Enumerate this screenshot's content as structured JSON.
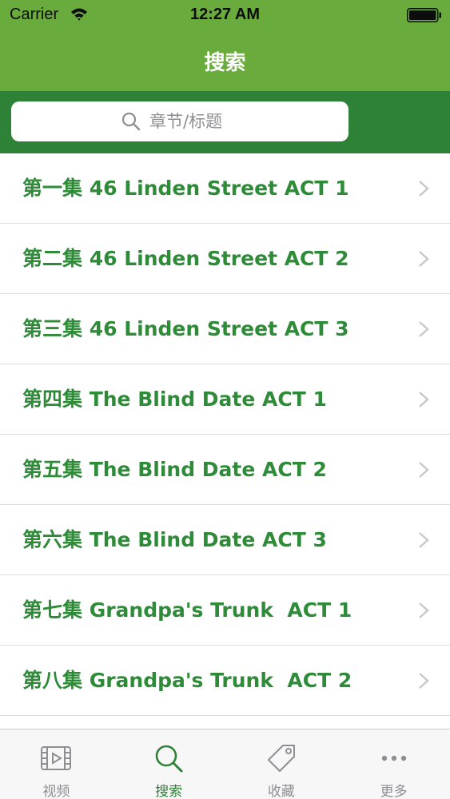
{
  "status_bar": {
    "carrier": "Carrier",
    "time": "12:27 AM"
  },
  "nav": {
    "title": "搜索"
  },
  "search": {
    "placeholder": "章节/标题"
  },
  "list": {
    "items": [
      {
        "label": "第一集 46 Linden Street ACT 1"
      },
      {
        "label": "第二集 46 Linden Street ACT 2"
      },
      {
        "label": "第三集 46 Linden Street ACT 3"
      },
      {
        "label": "第四集 The Blind Date ACT 1"
      },
      {
        "label": "第五集 The Blind Date ACT 2"
      },
      {
        "label": "第六集 The Blind Date ACT 3"
      },
      {
        "label": "第七集 Grandpa's Trunk  ACT 1"
      },
      {
        "label": "第八集 Grandpa's Trunk  ACT 2"
      }
    ]
  },
  "tabs": [
    {
      "label": "视频",
      "icon": "video-icon",
      "active": false
    },
    {
      "label": "搜索",
      "icon": "search-icon",
      "active": true
    },
    {
      "label": "收藏",
      "icon": "tag-icon",
      "active": false
    },
    {
      "label": "更多",
      "icon": "more-icon",
      "active": false
    }
  ],
  "colors": {
    "nav_green": "#6aab3e",
    "search_bar_green": "#2e8238",
    "item_text_green": "#2e8b38",
    "tab_active": "#2e8238",
    "tab_inactive": "#8e8e93"
  }
}
